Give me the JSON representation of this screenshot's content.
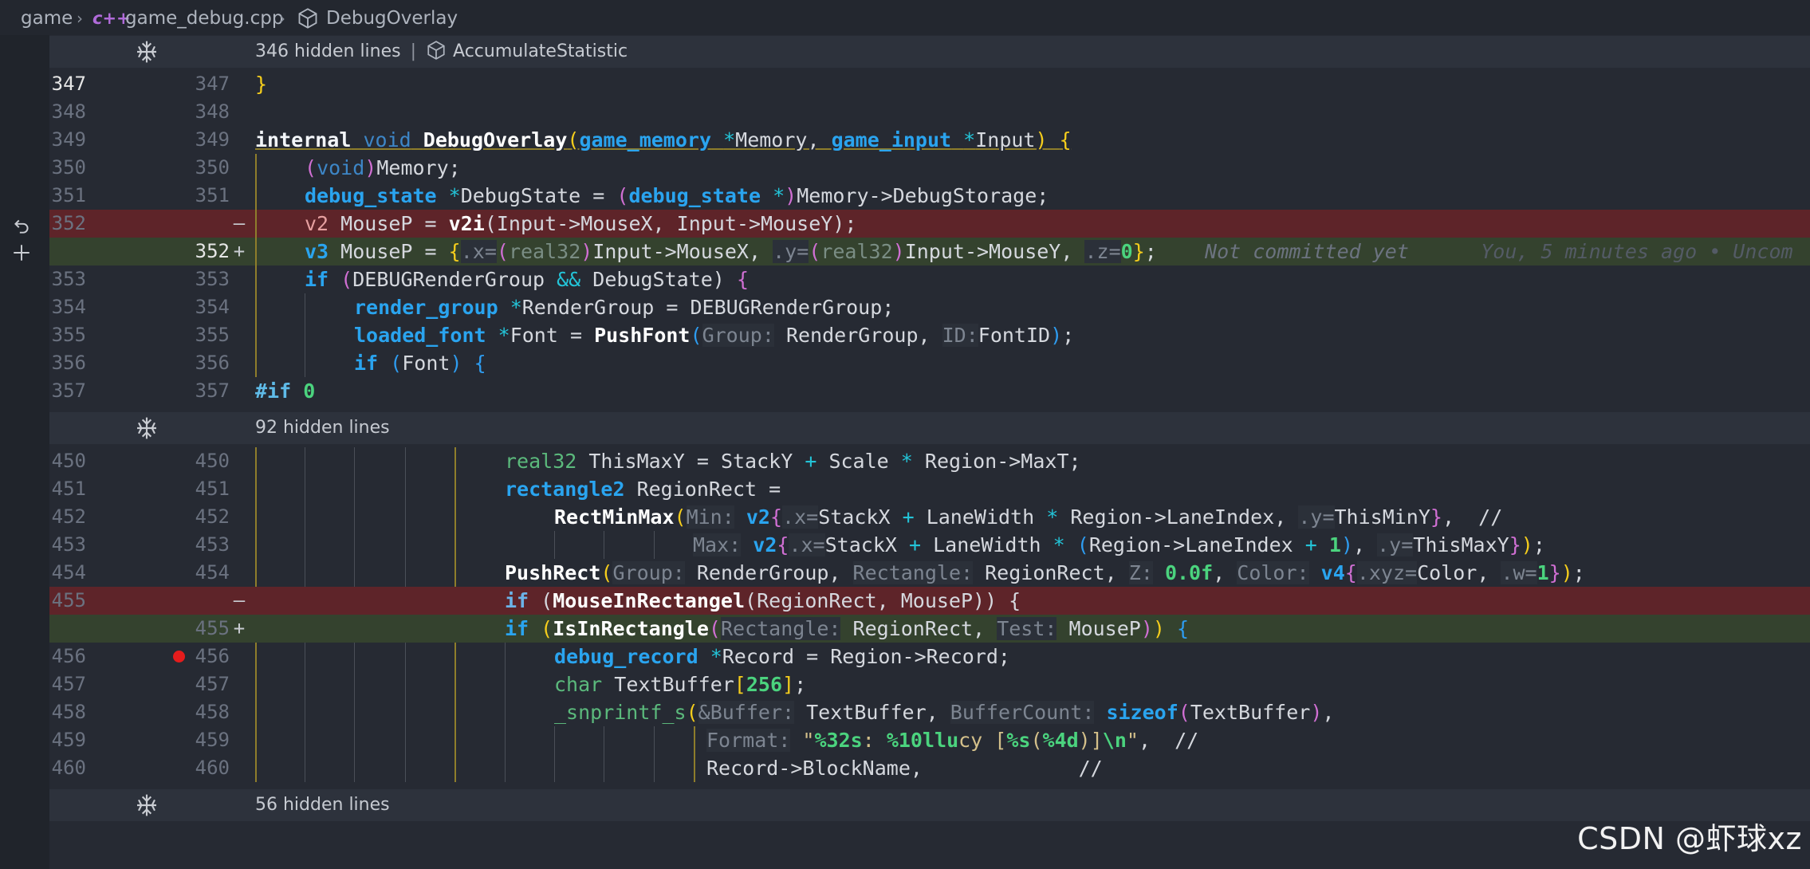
{
  "breadcrumb": {
    "folder": "game",
    "file": "game_debug.cpp",
    "file_icon": "c++",
    "symbol": "DebugOverlay"
  },
  "folds": [
    {
      "hidden": "346 hidden lines",
      "sep": "|",
      "symbol": "AccumulateStatistic"
    },
    {
      "hidden": "92 hidden lines"
    },
    {
      "hidden": "56 hidden lines"
    }
  ],
  "lines": [
    {
      "l": "347",
      "r": "347"
    },
    {
      "l": "348",
      "r": "348"
    },
    {
      "l": "349",
      "r": "349"
    },
    {
      "l": "350",
      "r": "350"
    },
    {
      "l": "351",
      "r": "351"
    },
    {
      "l": "352",
      "r": "",
      "mark": "—"
    },
    {
      "l": "",
      "r": "352",
      "mark": "+"
    },
    {
      "l": "353",
      "r": "353"
    },
    {
      "l": "354",
      "r": "354"
    },
    {
      "l": "355",
      "r": "355"
    },
    {
      "l": "356",
      "r": "356"
    },
    {
      "l": "357",
      "r": "357"
    },
    {
      "l": "450",
      "r": "450"
    },
    {
      "l": "451",
      "r": "451"
    },
    {
      "l": "452",
      "r": "452"
    },
    {
      "l": "453",
      "r": "453"
    },
    {
      "l": "454",
      "r": "454"
    },
    {
      "l": "455",
      "r": "",
      "mark": "—"
    },
    {
      "l": "",
      "r": "455",
      "mark": "+"
    },
    {
      "l": "456",
      "r": "456"
    },
    {
      "l": "457",
      "r": "457"
    },
    {
      "l": "458",
      "r": "458"
    },
    {
      "l": "459",
      "r": "459"
    },
    {
      "l": "460",
      "r": "460"
    }
  ],
  "code": {
    "c347": "}",
    "c349": {
      "k": "internal",
      "v": "void",
      "f": "DebugOverlay",
      "t1": "game_memory",
      "a1": "Memory,",
      "t2": "game_input",
      "a2": "Input"
    },
    "c350": {
      "v": "void",
      "a": "Memory;"
    },
    "c351": {
      "t": "debug_state",
      "a": "DebugState =",
      "t2": "debug_state",
      "b": "Memory->DebugStorage;"
    },
    "c352d": {
      "t": "v2",
      "a": "MouseP =",
      "f": "v2i",
      "b": "Input->MouseX, Input->MouseY);"
    },
    "c352a": {
      "t": "v3",
      "a": "MouseP =",
      "x": ".x=",
      "real32": "real32",
      "b": "Input->MouseX,",
      "y": ".y=",
      "c": "Input->MouseY,",
      "z": ".z=",
      "zero": "0",
      "semi": ";",
      "blame": "Not committed yet",
      "blame2": "You, 5 minutes ago • Uncom"
    },
    "c353": {
      "k": "if",
      "a": "DEBUGRenderGroup",
      "op": "&&",
      "b": "DebugState)"
    },
    "c354": {
      "t": "render_group",
      "a": "RenderGroup = DEBUGRenderGroup;"
    },
    "c355": {
      "t": "loaded_font",
      "a": "Font =",
      "f": "PushFont",
      "h1": "Group:",
      "b": "RenderGroup,",
      "h2": "ID:",
      "c": "FontID"
    },
    "c356": {
      "k": "if",
      "a": "Font"
    },
    "c357": {
      "pp": "#if",
      "n": "0"
    },
    "c450": {
      "t": "real32",
      "a": "ThisMaxY = StackY",
      "b": "Scale",
      "c": "Region->MaxT;"
    },
    "c451": {
      "t": "rectangle2",
      "a": "RegionRect ="
    },
    "c452": {
      "f": "RectMinMax",
      "h": "Min:",
      "t": "v2",
      "x": ".x=",
      "a": "StackX",
      "b": "LaneWidth",
      "c": "Region->LaneIndex,",
      "y": ".y=",
      "d": "ThisMinY",
      "cm": "//"
    },
    "c453": {
      "h": "Max:",
      "t": "v2",
      "x": ".x=",
      "a": "StackX",
      "b": "LaneWidth",
      "c": "Region->LaneIndex",
      "n": "1",
      "y": ".y=",
      "d": "ThisMaxY"
    },
    "c454": {
      "f": "PushRect",
      "h1": "Group:",
      "a": "RenderGroup,",
      "h2": "Rectangle:",
      "b": "RegionRect,",
      "h3": "Z:",
      "n1": "0.0f",
      "h4": "Color:",
      "t": "v4",
      "x": ".xyz=",
      "c": "Color,",
      "w": ".w=",
      "n2": "1"
    },
    "c455d": {
      "k": "if",
      "f": "MouseInRectangel",
      "a": "RegionRect, MouseP)) {"
    },
    "c455a": {
      "k": "if",
      "f": "IsInRectangle",
      "h1": "Rectangle:",
      "a": "RegionRect,",
      "h2": "Test:",
      "b": "MouseP"
    },
    "c456": {
      "t": "debug_record",
      "a": "Record = Region->Record;"
    },
    "c457": {
      "t": "char",
      "a": "TextBuffer",
      "n": "256"
    },
    "c458": {
      "f": "_snprintf_s",
      "h1": "&Buffer:",
      "a": "TextBuffer,",
      "h2": "BufferCount:",
      "kw": "sizeof",
      "b": "TextBuffer"
    },
    "c459": {
      "h": "Format:",
      "s1": "\"",
      "e1": "%32s",
      "s2": ": ",
      "e2": "%10llu",
      "s3": "cy [",
      "e3": "%s",
      "s4": "(",
      "e4": "%4d",
      "s5": ")]",
      "e5": "\\n",
      "s6": "\"",
      "cm": "//"
    },
    "c460": {
      "a": "Record->BlockName,",
      "cm": "//"
    }
  },
  "icons": {
    "fold": "fold-icon",
    "cube": "symbol-cube-icon",
    "revert": "revert-icon",
    "add": "add-icon",
    "breakpoint": "breakpoint-icon"
  },
  "watermark": "CSDN @虾球xz",
  "colors": {
    "deleted_line": "#5e2429",
    "added_line": "#34422e",
    "breakpoint": "#e51c1c",
    "type": "#2aa4ef",
    "number": "#4bd37e"
  }
}
